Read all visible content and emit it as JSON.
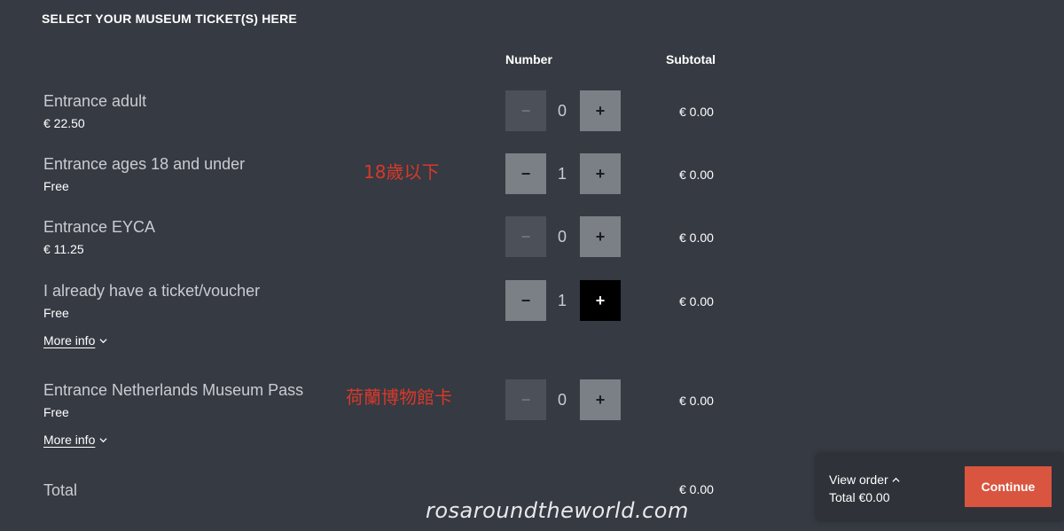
{
  "header": {
    "title": "SELECT YOUR MUSEUM TICKET(S) HERE",
    "number_label": "Number",
    "subtotal_label": "Subtotal"
  },
  "tickets": [
    {
      "name": "Entrance adult",
      "price": "€ 22.50",
      "quantity": "0",
      "subtotal": "€ 0.00",
      "minus": "−",
      "plus": "+",
      "minus_enabled": false
    },
    {
      "name": "Entrance ages 18 and under",
      "price": "Free",
      "quantity": "1",
      "subtotal": "€ 0.00",
      "minus": "−",
      "plus": "+",
      "minus_enabled": true
    },
    {
      "name": "Entrance EYCA",
      "price": "€ 11.25",
      "quantity": "0",
      "subtotal": "€ 0.00",
      "minus": "−",
      "plus": "+",
      "minus_enabled": false
    },
    {
      "name": "I already have a ticket/voucher",
      "price": "Free",
      "quantity": "1",
      "subtotal": "€ 0.00",
      "minus": "−",
      "plus": "+",
      "minus_enabled": true,
      "more_info": "More info"
    },
    {
      "name": "Entrance Netherlands Museum Pass",
      "price": "Free",
      "quantity": "0",
      "subtotal": "€ 0.00",
      "minus": "−",
      "plus": "+",
      "minus_enabled": false,
      "more_info": "More info"
    }
  ],
  "annotations": {
    "under18": "18歲以下",
    "museum_pass": "荷蘭博物館卡"
  },
  "total": {
    "label": "Total",
    "value": "€ 0.00"
  },
  "order_panel": {
    "view_order": "View order",
    "total": "Total €0.00",
    "continue": "Continue"
  },
  "watermark": "rosaroundtheworld.com",
  "colors": {
    "background": "#363a42",
    "continue": "#d9553f",
    "annotation": "#d6392b"
  }
}
